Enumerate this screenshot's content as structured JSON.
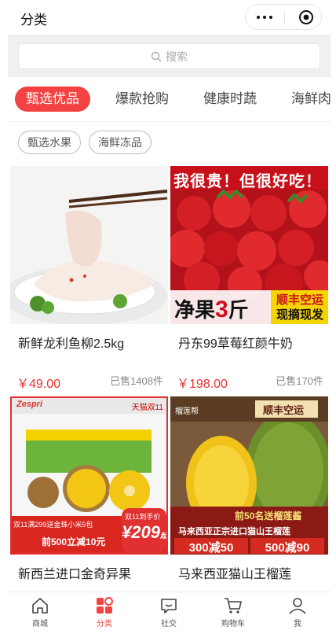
{
  "header": {
    "title": "分类"
  },
  "search": {
    "placeholder": "搜索"
  },
  "tabs": [
    {
      "label": "甄选优品",
      "active": true
    },
    {
      "label": "爆款抢购",
      "active": false
    },
    {
      "label": "健康时蔬",
      "active": false
    },
    {
      "label": "海鲜肉",
      "active": false
    }
  ],
  "subcategories": [
    {
      "label": "甄选水果"
    },
    {
      "label": "海鲜冻品"
    }
  ],
  "products": [
    {
      "name": "新鲜龙利鱼柳2.5kg",
      "price": "￥49.00",
      "sold": "已售1408件"
    },
    {
      "name": "丹东99草莓红颜牛奶",
      "price": "￥198.00",
      "sold": "已售170件",
      "banner_top": "我很贵！但很好吃！",
      "banner_left_a": "净果",
      "banner_left_b": "3",
      "banner_left_c": "斤",
      "banner_right_a": "顺丰空运",
      "banner_right_b": "现摘现发"
    },
    {
      "name": "新西兰进口金奇异果",
      "brand_tag": "Zespri",
      "store_tag": "天猫双11",
      "promo_a": "双11满299送金珠小米5包",
      "promo_b": "前500立减10元",
      "badge_top": "双11到手价",
      "badge_price": "¥209",
      "badge_unit": "起"
    },
    {
      "name": "马来西亚猫山王榴莲",
      "tag_brand": "榴莲帮",
      "tag_ship": "顺丰空运",
      "promo_gift": "前50名送榴莲酱",
      "promo_title": "马来西亚正宗进口猫山王榴莲",
      "promo_c1": "300减50",
      "promo_c2": "500减90"
    }
  ],
  "nav": [
    {
      "label": "商城",
      "icon": "home-icon"
    },
    {
      "label": "分类",
      "icon": "category-icon",
      "active": true
    },
    {
      "label": "社交",
      "icon": "chat-icon"
    },
    {
      "label": "购物车",
      "icon": "cart-icon"
    },
    {
      "label": "我",
      "icon": "user-icon"
    }
  ],
  "colors": {
    "accent": "#f44141",
    "price": "#f23030"
  }
}
